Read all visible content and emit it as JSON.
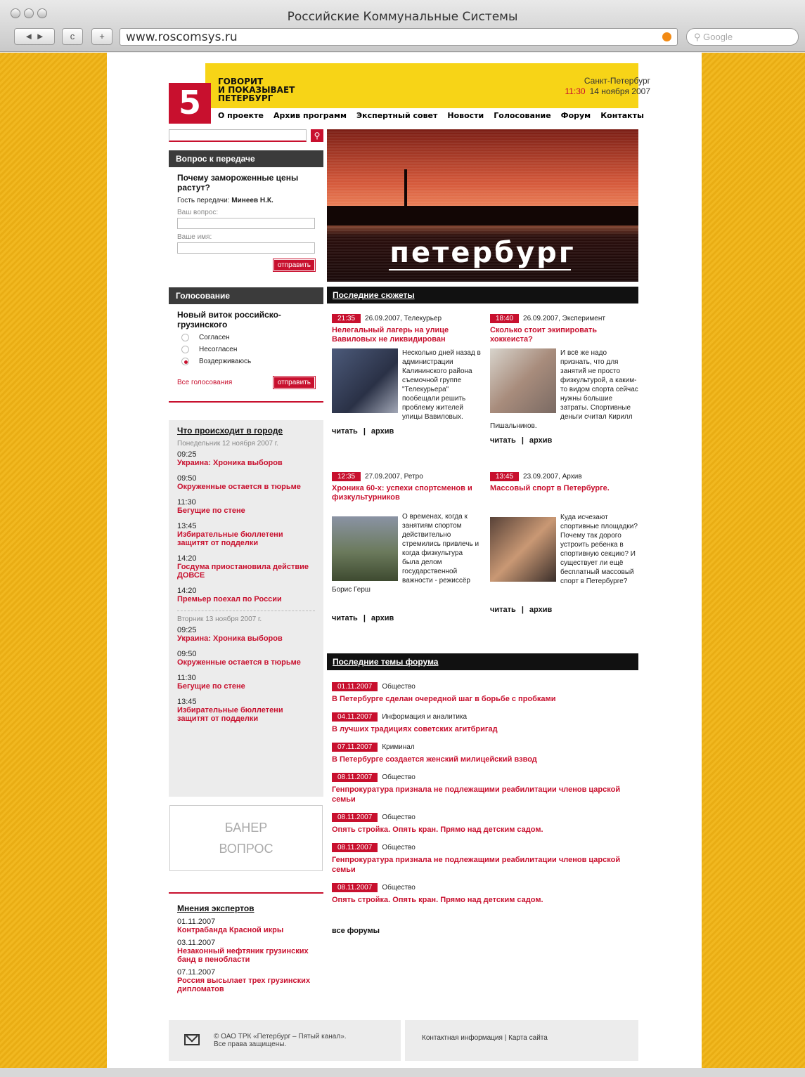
{
  "browser": {
    "title": "Российские Коммунальные Системы",
    "url": "www.roscomsys.ru",
    "search_placeholder": "Google",
    "back": "◄ ►",
    "reload": "c",
    "add": "+"
  },
  "header": {
    "logo": "5",
    "slogan": [
      "ГОВОРИТ",
      "И ПОКАЗЫВАЕТ",
      "ПЕТЕРБУРГ"
    ],
    "city": "Санкт-Петербург",
    "time": "11:30",
    "date": "14 ноября 2007",
    "nav": [
      "О проекте",
      "Архив программ",
      "Экспертный совет",
      "Новости",
      "Голосование",
      "Форум",
      "Контакты"
    ]
  },
  "question": {
    "head": "Вопрос к передаче",
    "title": "Почему замороженные цены растут?",
    "guest_label": "Гость передачи:",
    "guest": "Минеев Н.К.",
    "your_question": "Ваш вопрос:",
    "your_name": "Ваше имя:",
    "send": "отправить"
  },
  "vote": {
    "head": "Голосование",
    "title": "Новый виток российско-грузинского",
    "options": [
      "Согласен",
      "Несогласен",
      "Воздерживаюсь"
    ],
    "selected": 2,
    "all": "Все голосования",
    "send": "отправить"
  },
  "city_events": {
    "head": "Что происходит в городе",
    "days": [
      {
        "date": "Понедельник 12 ноября 2007 г.",
        "items": [
          {
            "time": "09:25",
            "title": "Украина: Хроника выборов"
          },
          {
            "time": "09:50",
            "title": "Окруженные остается в тюрьме"
          },
          {
            "time": "11:30",
            "title": "Бегущие по стене"
          },
          {
            "time": "13:45",
            "title": "Избирательные бюллетени защитят от подделки"
          },
          {
            "time": "14:20",
            "title": "Госдума приостановила действие ДОВСЕ"
          },
          {
            "time": "14:20",
            "title": "Премьер поехал по России"
          }
        ]
      },
      {
        "date": "Вторник 13 ноября 2007 г.",
        "items": [
          {
            "time": "09:25",
            "title": "Украина: Хроника выборов"
          },
          {
            "time": "09:50",
            "title": "Окруженные остается в тюрьме"
          },
          {
            "time": "11:30",
            "title": "Бегущие по стене"
          },
          {
            "time": "13:45",
            "title": "Избирательные бюллетени защитят от подделки"
          }
        ]
      }
    ]
  },
  "banner": {
    "line1": "БАНЕР",
    "line2": "ВОПРОС"
  },
  "experts": {
    "head": "Мнения экспертов",
    "items": [
      {
        "date": "01.11.2007",
        "title": "Контрабанда Красной икры"
      },
      {
        "date": "03.11.2007",
        "title": "Незаконный нефтяник грузинских банд в пенобласти"
      },
      {
        "date": "07.11.2007",
        "title": "Россия высылает трех грузинских дипломатов"
      }
    ]
  },
  "hero": {
    "text": "петербург"
  },
  "stories": {
    "head": "Последние сюжеты",
    "read": "читать",
    "archive": "архив",
    "items": [
      {
        "time": "21:35",
        "meta": "26.09.2007, Телекурьер",
        "title": "Нелегальный лагерь на улице Вавиловых не ликвидирован",
        "text": "Несколько дней назад в администрации Калининского района съемочной группе \"Телекурьера\" пообещали решить проблему жителей улицы Вавиловых."
      },
      {
        "time": "18:40",
        "meta": "26.09.2007, Эксперимент",
        "title": "Сколько стоит экипировать хоккеиста?",
        "text": "И всё же надо признать, что для занятий не просто физкультурой, а каким-то видом спорта сейчас нужны большие затраты. Спортивные деньги считал Кирилл Пишальников."
      },
      {
        "time": "12:35",
        "meta": "27.09.2007, Ретро",
        "title": "Хроника 60-х: успехи спортсменов и физкультурников",
        "text": "О временах, когда к занятиям спортом действительно стремились привлечь и когда физкультура была делом государственной важности - режиссёр Борис Герш"
      },
      {
        "time": "13:45",
        "meta": "23.09.2007, Архив",
        "title": "Массовый спорт в Петербурге.",
        "text": "Куда исчезают спортивные площадки? Почему так дорого устроить ребенка в спортивную секцию? И существует ли ещё бесплатный массовый спорт в Петербурге?"
      }
    ]
  },
  "forum": {
    "head": "Последние темы форума",
    "all": "все форумы",
    "items": [
      {
        "date": "01.11.2007",
        "cat": "Общество",
        "title": "В Петербурге сделан очередной шаг в борьбе с пробками"
      },
      {
        "date": "04.11.2007",
        "cat": "Информация и аналитика",
        "title": "В лучших традициях советских агитбригад"
      },
      {
        "date": "07.11.2007",
        "cat": "Криминал",
        "title": "В Петербурге создается женский милицейский взвод"
      },
      {
        "date": "08.11.2007",
        "cat": "Общество",
        "title": "Генпрокуратура признала не подлежащими реабилитации членов царской семьи"
      },
      {
        "date": "08.11.2007",
        "cat": "Общество",
        "title": "Опять стройка. Опять кран. Прямо над детским садом."
      },
      {
        "date": "08.11.2007",
        "cat": "Общество",
        "title": "Генпрокуратура признала не подлежащими реабилитации членов царской семьи"
      },
      {
        "date": "08.11.2007",
        "cat": "Общество",
        "title": "Опять стройка. Опять кран. Прямо над детским садом."
      }
    ]
  },
  "footer": {
    "copyright": "© ОАО ТРК «Петербург – Пятый канал».",
    "rights": "Все права защищены.",
    "contact": "Контактная информация",
    "sitemap": "Карта сайта",
    "sep": "|"
  }
}
